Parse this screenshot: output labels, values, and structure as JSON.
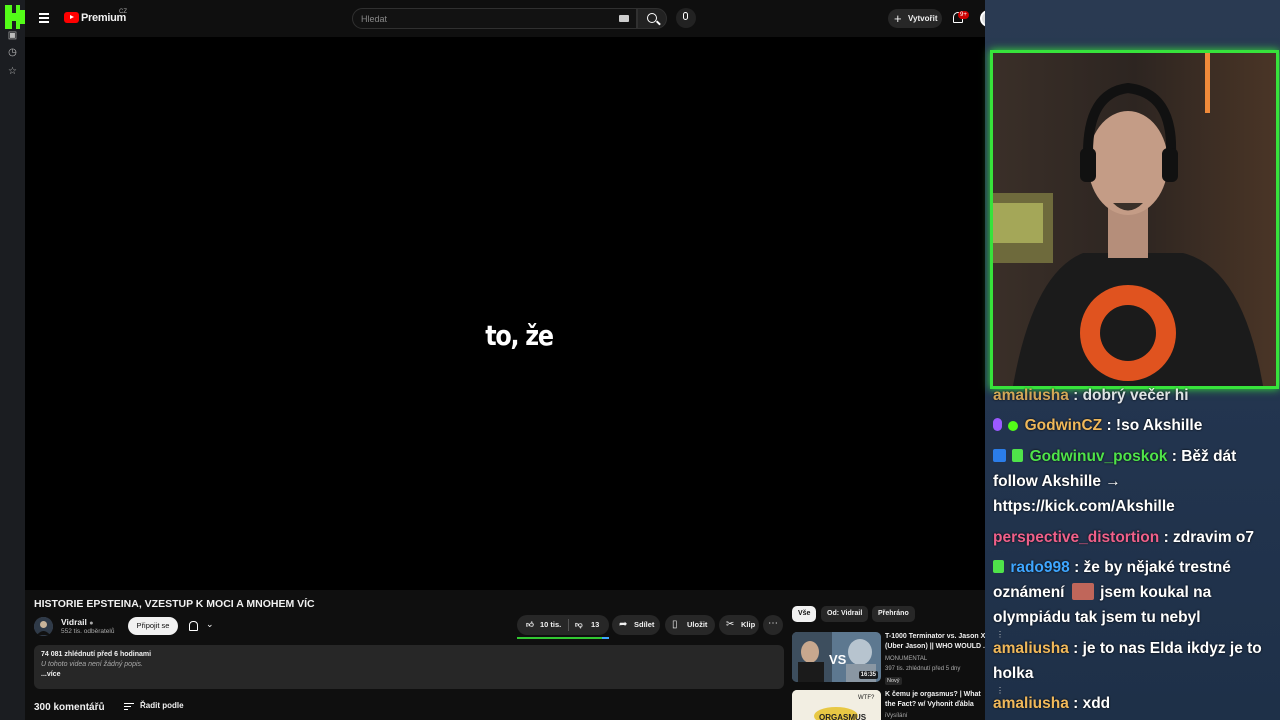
{
  "header": {
    "brand": "Premium",
    "region": "CZ",
    "search_placeholder": "Hledat",
    "create_label": "Vytvořit",
    "notifications_badge": "9+"
  },
  "video": {
    "subtitle": "to, že",
    "title": "HISTORIE EPSTEINA, VZESTUP K MOCI A MNOHEM VÍC",
    "channel_name": "Vidrail",
    "subscribers": "552 tis. odběratelů",
    "join_label": "Připojit se",
    "likes": "10 tis.",
    "dislikes": "13",
    "share_label": "Sdílet",
    "save_label": "Uložit",
    "clip_label": "Klip",
    "description": {
      "stats": "74 081 zhlédnutí  před 6 hodinami",
      "text": "U tohoto videa není žádný popis.",
      "more": "...více"
    },
    "comments_count": "300 komentářů",
    "sort_label": "Řadit podle"
  },
  "recommendations": {
    "chips": [
      "Vše",
      "Od: Vidrail",
      "Přehráno"
    ],
    "items": [
      {
        "title": "T-1000 Terminator vs. Jason X (Uber Jason) || WHO WOULD ...",
        "channel": "MONUMENTAL",
        "meta": "397 tis. zhlédnutí  před 5 dny",
        "badge": "Nový",
        "duration": "16:35"
      },
      {
        "title": "K čemu je orgasmus? | What the Fact? w/ Vyhonit ďábla",
        "channel": "iVysílání",
        "meta": "",
        "badge": "",
        "duration": ""
      }
    ]
  },
  "chat": {
    "messages": [
      {
        "user": "amaliusha",
        "text": ": dobrý večer hi",
        "color": "#f0b85a"
      },
      {
        "user": "GodwinCZ",
        "text": ": !so Akshille",
        "color": "#f0b85a"
      },
      {
        "user": "Godwinuv_poskok",
        "text": ": Běž dát follow Akshille → https://kick.com/Akshille",
        "color": "#4fe34a"
      },
      {
        "user": "perspective_distortion",
        "text": ": zdravim o7",
        "color": "#f0608a"
      },
      {
        "user": "rado998",
        "text": ": že by nějaké trestné oznámení",
        "text2": "jsem koukal na olympiádu tak jsem tu nebyl",
        "color": "#3ea6ff"
      },
      {
        "user": "amaliusha",
        "text": ": je to nas Elda ikdyz je to holka",
        "color": "#f0b85a"
      },
      {
        "user": "amaliusha",
        "text": ": xdd",
        "color": "#f0b85a"
      }
    ]
  }
}
